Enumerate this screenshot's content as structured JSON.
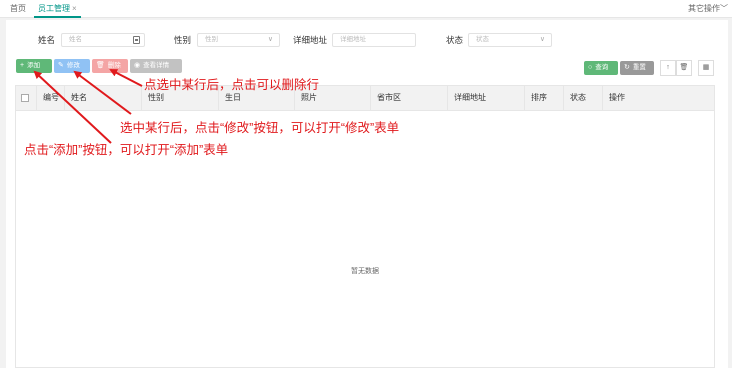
{
  "tabs": {
    "home": "首页",
    "active": "员工管理",
    "close": "×",
    "more": "其它操作"
  },
  "search": {
    "name_label": "姓名",
    "name_placeholder": "姓名",
    "gender_label": "性别",
    "gender_placeholder": "性别",
    "address_label": "详细地址",
    "address_placeholder": "详细地址",
    "status_label": "状态",
    "status_placeholder": "状态"
  },
  "toolbar": {
    "add": "添加",
    "edit": "修改",
    "delete": "删除",
    "view": "查看详情",
    "search": "查询",
    "reset": "重置"
  },
  "table": {
    "columns": [
      "编号",
      "姓名",
      "性别",
      "生日",
      "照片",
      "省市区",
      "详细地址",
      "排序",
      "状态",
      "操作"
    ],
    "empty_text": "暂无数据"
  },
  "annotations": {
    "delete_hint": "点选中某行后，点击可以删除行",
    "edit_hint": "选中某行后，点击“修改”按钮，可以打开“修改”表单",
    "add_hint": "点击“添加”按钮，可以打开“添加”表单"
  },
  "colors": {
    "annotation": "#e0191c",
    "primary_green": "#5fb878",
    "edit_blue": "#90c2f4",
    "delete_red": "#f4a5a5",
    "active_tab": "#009688"
  }
}
